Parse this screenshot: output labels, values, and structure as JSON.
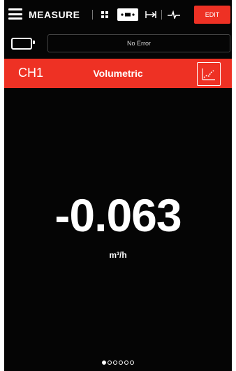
{
  "header": {
    "title": "MEASURE",
    "edit_label": "EDIT",
    "mode_icons": [
      "grid-icon",
      "multi-dot-icon",
      "range-icon",
      "waveform-icon"
    ],
    "active_mode": 1
  },
  "status": {
    "battery_icon": "battery-icon",
    "error_text": "No Error"
  },
  "channel": {
    "label": "CH1",
    "quantity": "Volumetric",
    "graph_icon": "graph-icon"
  },
  "reading": {
    "value": "-0.063",
    "unit": "m³/h"
  },
  "pager": {
    "pages": 6,
    "current": 1
  },
  "colors": {
    "accent": "#ee3124",
    "background": "#050505",
    "text": "#ffffff"
  }
}
